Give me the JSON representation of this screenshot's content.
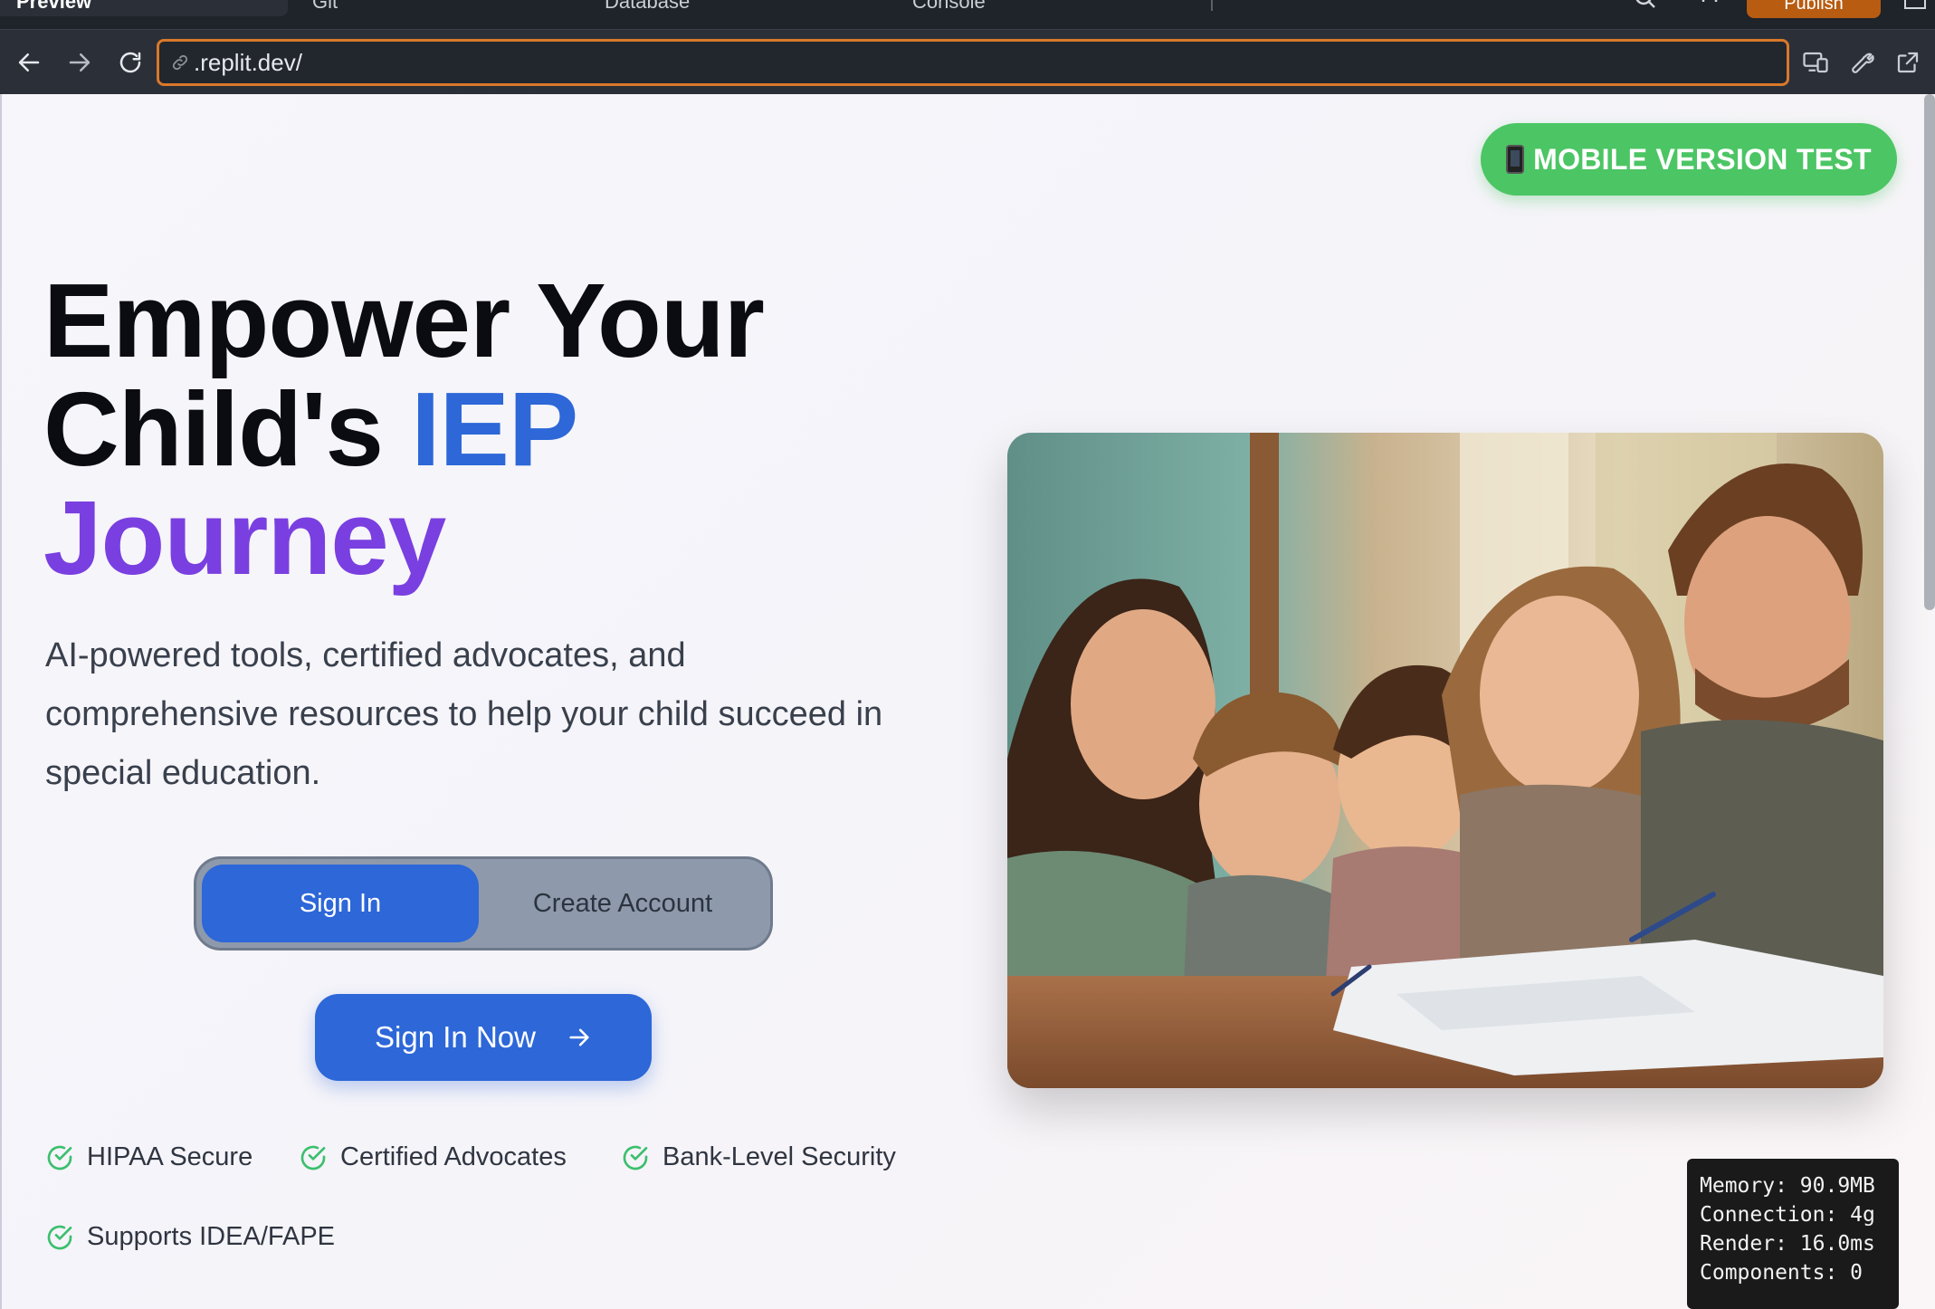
{
  "ide_tabs": {
    "preview_label": "Preview",
    "git_label": "Git",
    "database_label": "Database",
    "console_label": "Console",
    "publish_label": "Publish"
  },
  "browser": {
    "url": ".replit.dev/"
  },
  "page": {
    "mobile_test_button": "MOBILE VERSION TEST",
    "hero_title_line1": "Empower Your",
    "hero_title_line2_plain": "Child's ",
    "hero_title_line2_accent": "IEP",
    "hero_title_line3": "Journey",
    "hero_subtitle": "AI-powered tools, certified advocates, and comprehensive resources to help your child succeed in special education.",
    "toggle_signin": "Sign In",
    "toggle_create": "Create Account",
    "primary_cta": "Sign In Now",
    "trust_badges": [
      "HIPAA Secure",
      "Certified Advocates",
      "Bank-Level Security",
      "Supports IDEA/FAPE"
    ]
  },
  "perf_panel": {
    "memory": "Memory: 90.9MB",
    "connection": "Connection: 4g",
    "render": "Render: 16.0ms",
    "components": "Components: 0"
  },
  "colors": {
    "accent_blue": "#2d67d8",
    "accent_purple": "#7a3fe0",
    "success_green": "#4cc564",
    "url_focus_orange": "#d9782a"
  },
  "icons": {
    "back": "arrow-left-icon",
    "forward": "arrow-right-icon",
    "reload": "reload-icon",
    "link": "link-icon",
    "devices": "devices-icon",
    "devtools": "wrench-icon",
    "open_external": "external-link-icon",
    "check": "check-circle-icon",
    "cta_arrow": "arrow-right-icon",
    "phone": "mobile-phone-icon"
  }
}
